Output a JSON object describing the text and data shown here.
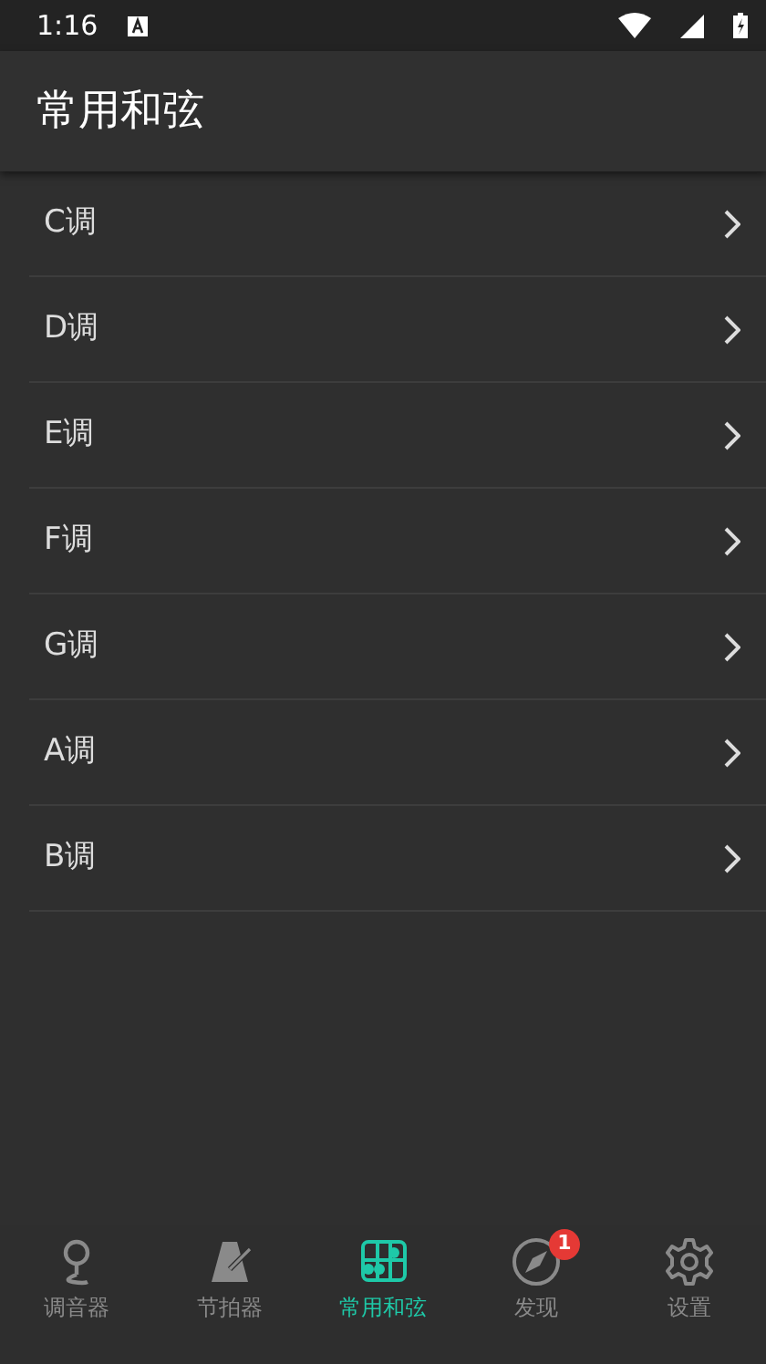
{
  "status_bar": {
    "time": "1:16"
  },
  "app_bar": {
    "title": "常用和弦"
  },
  "keys": [
    {
      "label": "C调"
    },
    {
      "label": "D调"
    },
    {
      "label": "E调"
    },
    {
      "label": "F调"
    },
    {
      "label": "G调"
    },
    {
      "label": "A调"
    },
    {
      "label": "B调"
    }
  ],
  "bottom_nav": [
    {
      "kind": "tuner",
      "label": "调音器",
      "selected": false
    },
    {
      "kind": "metronome",
      "label": "节拍器",
      "selected": false
    },
    {
      "kind": "chords",
      "label": "常用和弦",
      "selected": true
    },
    {
      "kind": "discover",
      "label": "发现",
      "selected": false,
      "badge": "1"
    },
    {
      "kind": "settings",
      "label": "设置",
      "selected": false
    }
  ]
}
